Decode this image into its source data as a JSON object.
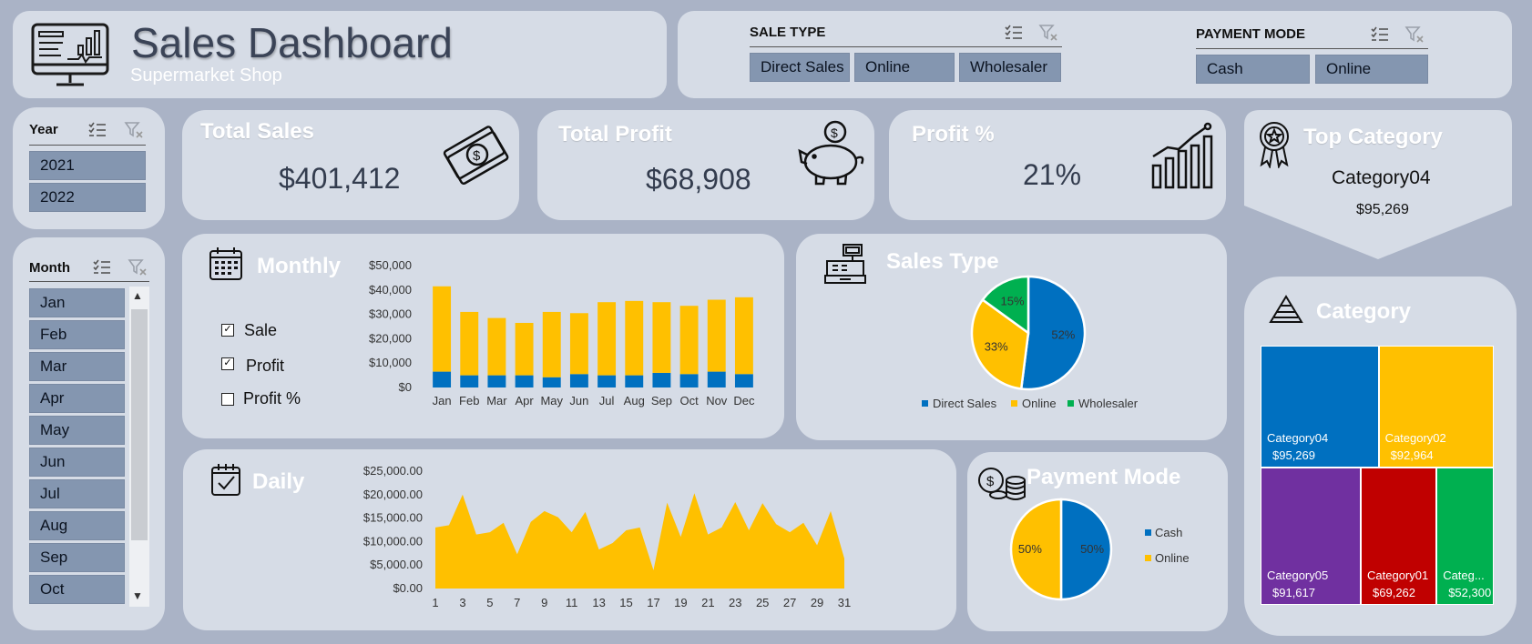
{
  "header": {
    "title": "Sales Dashboard",
    "subtitle": "Supermarket Shop"
  },
  "sale_type_slicer": {
    "title": "SALE TYPE",
    "items": [
      "Direct Sales",
      "Online",
      "Wholesaler"
    ]
  },
  "payment_mode_slicer": {
    "title": "PAYMENT MODE",
    "items": [
      "Cash",
      "Online"
    ]
  },
  "year_slicer": {
    "title": "Year",
    "items": [
      "2021",
      "2022"
    ]
  },
  "month_slicer": {
    "title": "Month",
    "items": [
      "Jan",
      "Feb",
      "Mar",
      "Apr",
      "May",
      "Jun",
      "Jul",
      "Aug",
      "Sep",
      "Oct"
    ]
  },
  "kpis": {
    "total_sales": {
      "label": "Total Sales",
      "value": "$401,412"
    },
    "total_profit": {
      "label": "Total Profit",
      "value": "$68,908"
    },
    "profit_pct": {
      "label": "Profit %",
      "value": "21%"
    }
  },
  "top_category": {
    "label": "Top Category",
    "name": "Category04",
    "value": "$95,269"
  },
  "monthly": {
    "title": "Monthly",
    "checkboxes": [
      {
        "label": "Sale",
        "checked": true
      },
      {
        "label": "Profit",
        "checked": true
      },
      {
        "label": "Profit %",
        "checked": false
      }
    ]
  },
  "sales_type_section": {
    "title": "Sales Type"
  },
  "daily": {
    "title": "Daily"
  },
  "payment_mode_section": {
    "title": "Payment Mode"
  },
  "category_section": {
    "title": "Category"
  },
  "colors": {
    "blue": "#0070c0",
    "yellow": "#ffc000",
    "green": "#00b050",
    "purple": "#7030a0",
    "red": "#c00000",
    "panel": "#d6dce6",
    "background": "#aab3c6"
  },
  "chart_data": [
    {
      "id": "monthly",
      "type": "bar",
      "stacked": true,
      "categories": [
        "Jan",
        "Feb",
        "Mar",
        "Apr",
        "May",
        "Jun",
        "Jul",
        "Aug",
        "Sep",
        "Oct",
        "Nov",
        "Dec"
      ],
      "series": [
        {
          "color": "#0070c0",
          "values": [
            6500,
            5000,
            5000,
            5000,
            4200,
            5500,
            5000,
            5000,
            6000,
            5500,
            6500,
            5500
          ]
        },
        {
          "color": "#ffc000",
          "values": [
            35000,
            26000,
            23500,
            21500,
            26800,
            25000,
            30000,
            30500,
            29000,
            28000,
            29500,
            31500
          ]
        }
      ],
      "ylim": [
        0,
        50000
      ],
      "yticks": [
        "$0",
        "$10,000",
        "$20,000",
        "$30,000",
        "$40,000",
        "$50,000"
      ],
      "grid": false
    },
    {
      "id": "sales_type",
      "type": "pie",
      "labels": [
        "Direct Sales",
        "Online",
        "Wholesaler"
      ],
      "values": [
        52,
        33,
        15
      ],
      "data_labels": [
        "52%",
        "33%",
        "15%"
      ],
      "colors": [
        "#0070c0",
        "#ffc000",
        "#00b050"
      ],
      "legend": "bottom"
    },
    {
      "id": "daily",
      "type": "area",
      "x": [
        1,
        2,
        3,
        4,
        5,
        6,
        7,
        8,
        9,
        10,
        11,
        12,
        13,
        14,
        15,
        16,
        17,
        18,
        19,
        20,
        21,
        22,
        23,
        24,
        25,
        26,
        27,
        28,
        29,
        30,
        31
      ],
      "values": [
        13000,
        13500,
        20000,
        11500,
        12000,
        14000,
        7300,
        14200,
        16500,
        15200,
        12000,
        16300,
        8300,
        9700,
        12400,
        13000,
        3900,
        18300,
        11000,
        20300,
        11500,
        13000,
        18400,
        12400,
        18200,
        13700,
        12000,
        14000,
        9200,
        16500,
        6400
      ],
      "xticks": [
        "1",
        "3",
        "5",
        "7",
        "9",
        "11",
        "13",
        "15",
        "17",
        "19",
        "21",
        "23",
        "25",
        "27",
        "29",
        "31"
      ],
      "ylim": [
        0,
        25000
      ],
      "yticks": [
        "$0.00",
        "$5,000.00",
        "$10,000.00",
        "$15,000.00",
        "$20,000.00",
        "$25,000.00"
      ],
      "color": "#ffc000"
    },
    {
      "id": "payment_mode",
      "type": "pie",
      "labels": [
        "Cash",
        "Online"
      ],
      "values": [
        50,
        50
      ],
      "data_labels": [
        "50%",
        "50%"
      ],
      "colors": [
        "#0070c0",
        "#ffc000"
      ],
      "legend": "right"
    },
    {
      "id": "category",
      "type": "treemap",
      "labels": [
        "Category04",
        "Category02",
        "Category05",
        "Category01",
        "Categ..."
      ],
      "values": [
        95269,
        92964,
        91617,
        69262,
        52300
      ],
      "value_labels": [
        "$95,269",
        "$92,964",
        "$91,617",
        "$69,262",
        "$52,300"
      ],
      "colors": [
        "#0070c0",
        "#ffc000",
        "#7030a0",
        "#c00000",
        "#00b050"
      ]
    }
  ]
}
